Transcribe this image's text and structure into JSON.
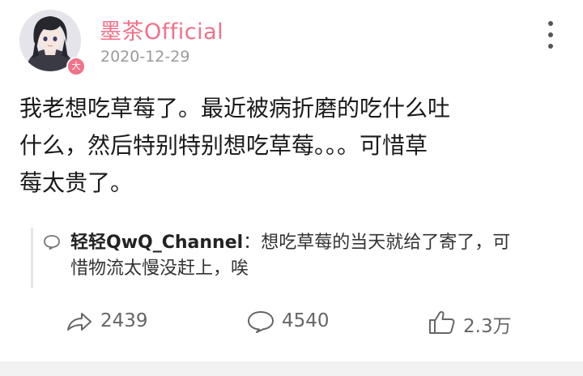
{
  "header": {
    "username": "墨茶Official",
    "date": "2020-12-29",
    "avatar_badge": "大"
  },
  "post": {
    "lines": [
      "我老想吃草莓了。最近被病折磨的吃什么吐",
      "什么，然后特别特别想吃草莓。。。可惜草",
      "莓太贵了。"
    ]
  },
  "repost": {
    "user": "轻轻QwQ_Channel",
    "separator": "：",
    "line1": "想吃草莓的当天就给了寄了，可",
    "line2": "惜物流太慢没赶上，唉"
  },
  "actions": {
    "share_count": "2439",
    "comment_count": "4540",
    "like_count": "2.3万"
  },
  "colors": {
    "accent": "#f0708a",
    "muted": "#9a9a9a",
    "icon": "#666666"
  }
}
